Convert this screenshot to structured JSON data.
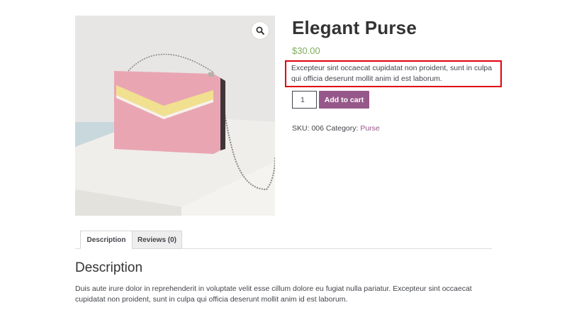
{
  "product": {
    "title": "Elegant Purse",
    "price": "$30.00",
    "short_description": "Excepteur sint occaecat cupidatat non proident, sunt in culpa qui officia deserunt mollit anim id est laborum.",
    "quantity": "1",
    "add_to_cart_label": "Add to cart",
    "sku_label": "SKU:",
    "sku_value": "006",
    "category_label": "Category:",
    "category_value": "Purse"
  },
  "gallery": {
    "zoom_icon": "magnifier-icon"
  },
  "tabs": [
    {
      "label": "Description",
      "active": true
    },
    {
      "label": "Reviews (0)",
      "active": false
    }
  ],
  "description": {
    "heading": "Description",
    "body": "Duis aute irure dolor in reprehenderit in voluptate velit esse cillum dolore eu fugiat nulla pariatur. Excepteur sint occaecat cupidatat non proident, sunt in culpa qui officia deserunt mollit anim id est laborum."
  },
  "colors": {
    "accent": "#96588a",
    "price": "#7fad5c",
    "highlight_box": "#e0000f"
  }
}
